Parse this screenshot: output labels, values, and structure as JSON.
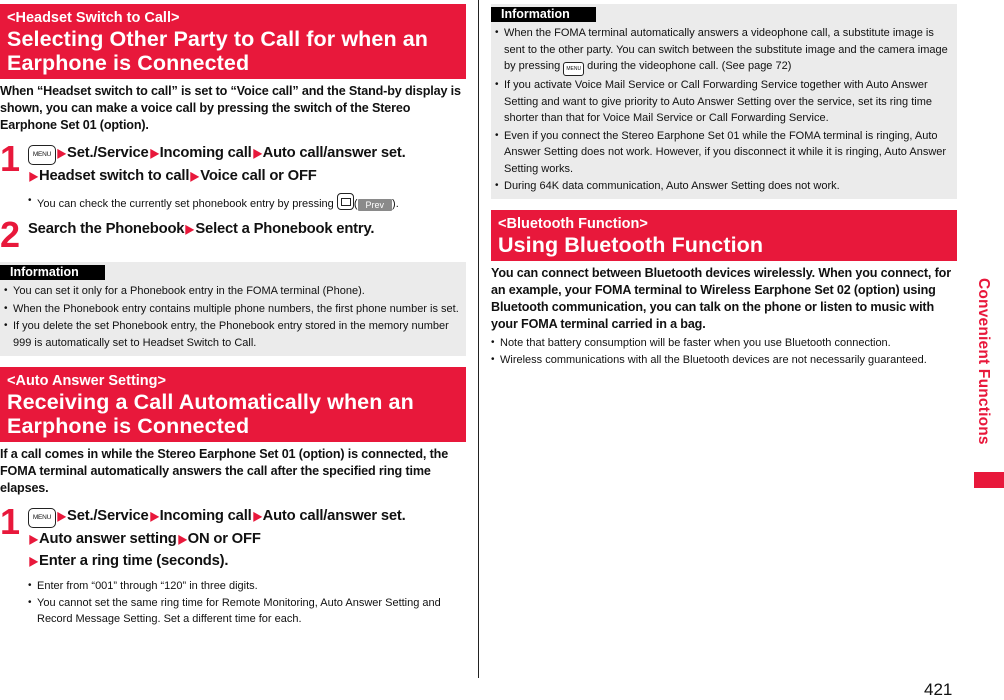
{
  "colors": {
    "accent": "#e8183b",
    "info_bg": "#ebebeb"
  },
  "left": {
    "section1": {
      "subtitle": "<Headset Switch to Call>",
      "title_line1": "Selecting Other Party to Call for when an",
      "title_line2": "Earphone is Connected",
      "lead": "When “Headset switch to call” is set to “Voice call” and the Stand-by display is shown, you can make a voice call by pressing the switch of the Stereo Earphone Set 01 (option).",
      "step1": {
        "num": "1",
        "key_icon": "menu-key-icon",
        "key_label": "MENU",
        "path1": [
          "Set./Service",
          "Incoming call",
          "Auto call/answer set."
        ],
        "path2": [
          "Headset switch to call",
          "Voice call or OFF"
        ],
        "note_prefix": "You can check the currently set phonebook entry by pressing",
        "note_key_icon": "mail-key-icon",
        "note_softkey": "Prev",
        "note_suffix": ")."
      },
      "step2": {
        "num": "2",
        "path": [
          "Search the Phonebook",
          "Select a Phonebook entry."
        ]
      },
      "info": {
        "tag": "Information",
        "items": [
          "You can set it only for a Phonebook entry in the FOMA terminal (Phone).",
          "When the Phonebook entry contains multiple phone numbers, the first phone number is set.",
          "If you delete the set Phonebook entry, the Phonebook entry stored in the memory number 999 is automatically set to Headset Switch to Call."
        ]
      }
    },
    "section2": {
      "subtitle": "<Auto Answer Setting>",
      "title_line1": "Receiving a Call Automatically when an",
      "title_line2": "Earphone is Connected",
      "lead": "If a call comes in while the Stereo Earphone Set 01 (option) is connected, the FOMA terminal automatically answers the call after the specified ring time elapses.",
      "step1": {
        "num": "1",
        "key_label": "MENU",
        "path1": [
          "Set./Service",
          "Incoming call",
          "Auto call/answer set."
        ],
        "path2": [
          "Auto answer setting",
          "ON or OFF"
        ],
        "path3": [
          "Enter a ring time (seconds)."
        ],
        "notes": [
          "Enter from “001” through “120” in three digits.",
          "You cannot set the same ring time for Remote Monitoring, Auto Answer Setting and Record Message Setting. Set a different time for each."
        ]
      }
    }
  },
  "right": {
    "info": {
      "tag": "Information",
      "item1_before": "When the FOMA terminal automatically answers a videophone call, a substitute image is sent to the other party. You can switch between the substitute image and the camera image by pressing",
      "item1_key": "MENU",
      "item1_after": "during the videophone call. (See page 72)",
      "items": [
        "If you activate Voice Mail Service or Call Forwarding Service together with Auto Answer Setting and want to give priority to Auto Answer Setting over the service, set its ring time shorter than that for Voice Mail Service or Call Forwarding Service.",
        "Even if you connect the Stereo Earphone Set 01 while the FOMA terminal is ringing, Auto Answer Setting does not work. However, if you disconnect it while it is ringing, Auto Answer Setting works.",
        "During 64K data communication, Auto Answer Setting does not work."
      ]
    },
    "section3": {
      "subtitle": "<Bluetooth Function>",
      "title": "Using Bluetooth Function",
      "lead": "You can connect between Bluetooth devices wirelessly. When you connect, for an example, your FOMA terminal to Wireless Earphone Set 02 (option) using Bluetooth communication, you can talk on the phone or listen to music with your FOMA terminal carried in a bag.",
      "notes": [
        "Note that battery consumption will be faster when you use Bluetooth connection.",
        "Wireless communications with all the Bluetooth devices are not necessarily guaranteed."
      ]
    }
  },
  "side_tab": "Convenient Functions",
  "page_number": "421"
}
